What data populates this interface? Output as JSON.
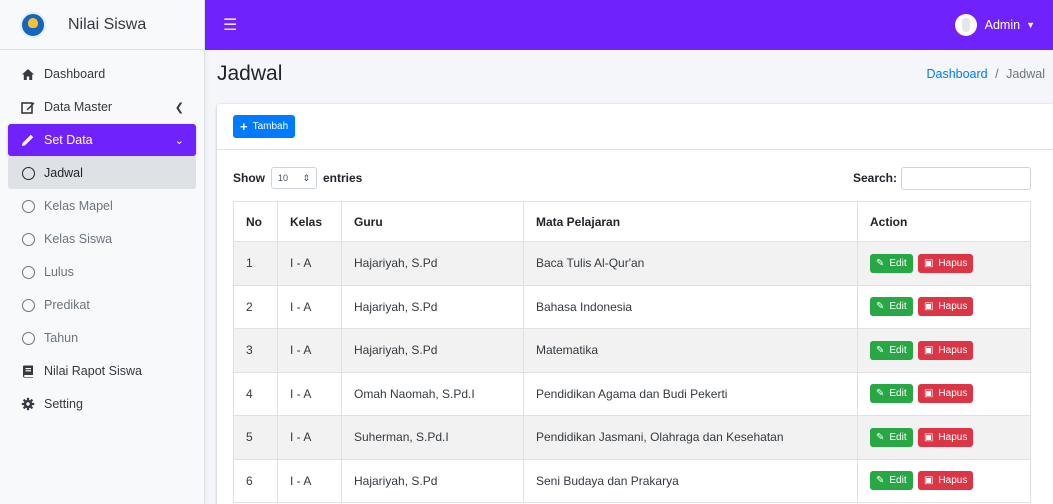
{
  "app": {
    "name": "Nilai Siswa"
  },
  "sidebar": {
    "items": [
      {
        "label": "Dashboard",
        "icon": "home-icon"
      },
      {
        "label": "Data Master",
        "icon": "edit-icon"
      },
      {
        "label": "Set Data",
        "icon": "pencil-icon"
      },
      {
        "label": "Jadwal"
      },
      {
        "label": "Kelas Mapel"
      },
      {
        "label": "Kelas Siswa"
      },
      {
        "label": "Lulus"
      },
      {
        "label": "Predikat"
      },
      {
        "label": "Tahun"
      },
      {
        "label": "Nilai Rapot Siswa",
        "icon": "book-icon"
      },
      {
        "label": "Setting",
        "icon": "gear-icon"
      }
    ]
  },
  "topbar": {
    "user": "Admin"
  },
  "page": {
    "title": "Jadwal",
    "breadcrumb": {
      "home": "Dashboard",
      "sep": "/",
      "current": "Jadwal"
    }
  },
  "card": {
    "add_label": "Tambah",
    "show_label": "Show",
    "entries_value": "10",
    "entries_label": "entries",
    "search_label": "Search:",
    "search_value": ""
  },
  "table": {
    "headers": [
      "No",
      "Kelas",
      "Guru",
      "Mata Pelajaran",
      "Action"
    ],
    "edit_label": "Edit",
    "delete_label": "Hapus",
    "rows": [
      {
        "no": "1",
        "kelas": "I - A",
        "guru": "Hajariyah, S.Pd",
        "mapel": "Baca Tulis Al-Qur'an"
      },
      {
        "no": "2",
        "kelas": "I - A",
        "guru": "Hajariyah, S.Pd",
        "mapel": "Bahasa Indonesia"
      },
      {
        "no": "3",
        "kelas": "I - A",
        "guru": "Hajariyah, S.Pd",
        "mapel": "Matematika"
      },
      {
        "no": "4",
        "kelas": "I - A",
        "guru": "Omah Naomah, S.Pd.I",
        "mapel": "Pendidikan Agama dan Budi Pekerti"
      },
      {
        "no": "5",
        "kelas": "I - A",
        "guru": "Suherman, S.Pd.I",
        "mapel": "Pendidikan Jasmani, Olahraga dan Kesehatan"
      },
      {
        "no": "6",
        "kelas": "I - A",
        "guru": "Hajariyah, S.Pd",
        "mapel": "Seni Budaya dan Prakarya"
      }
    ]
  },
  "colors": {
    "accent": "#6f22fb",
    "primary": "#007bff",
    "success": "#28a745",
    "danger": "#dc3545"
  }
}
